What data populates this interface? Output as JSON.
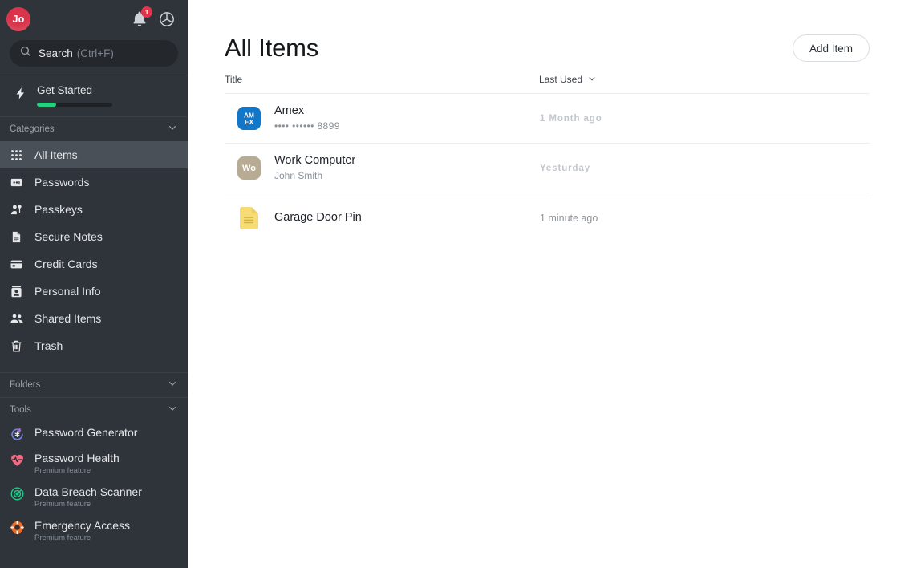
{
  "colors": {
    "sidebar_bg": "#2f343a",
    "sidebar_active": "#4a5057",
    "accent_green": "#27d07f",
    "badge_red": "#e0354b",
    "avatar_red": "#d9344a",
    "amex_blue": "#1277c9",
    "work_tan": "#b8ab93",
    "note_yellow": "#f7dc75"
  },
  "sidebar": {
    "avatar": {
      "initials": "Jo",
      "name": "user-avatar"
    },
    "notifications": {
      "icon": "bell-icon",
      "badge_count": "1"
    },
    "settings": {
      "icon": "gear-icon"
    },
    "search": {
      "icon": "search-icon",
      "label": "Search",
      "hint": "(Ctrl+F)",
      "placeholder": "Search (Ctrl+F)",
      "value": ""
    },
    "get_started": {
      "icon": "bolt-icon",
      "label": "Get Started",
      "progress_percent": 26
    },
    "categories": {
      "title": "Categories",
      "collapse_icon": "chevron-down-icon",
      "items": [
        {
          "label": "All Items",
          "icon": "grid-icon",
          "active": true
        },
        {
          "label": "Passwords",
          "icon": "password-icon",
          "active": false
        },
        {
          "label": "Passkeys",
          "icon": "passkey-icon",
          "active": false
        },
        {
          "label": "Secure Notes",
          "icon": "document-icon",
          "active": false
        },
        {
          "label": "Credit Cards",
          "icon": "credit-card-icon",
          "active": false
        },
        {
          "label": "Personal Info",
          "icon": "id-card-icon",
          "active": false
        },
        {
          "label": "Shared Items",
          "icon": "people-icon",
          "active": false
        },
        {
          "label": "Trash",
          "icon": "trash-icon",
          "active": false
        }
      ]
    },
    "folders": {
      "title": "Folders",
      "collapse_icon": "chevron-down-icon"
    },
    "tools": {
      "title": "Tools",
      "collapse_icon": "chevron-down-icon",
      "items": [
        {
          "label": "Password Generator",
          "sub": "",
          "icon": "password-generator-icon"
        },
        {
          "label": "Password Health",
          "sub": "Premium feature",
          "icon": "heart-pulse-icon"
        },
        {
          "label": "Data Breach Scanner",
          "sub": "Premium feature",
          "icon": "radar-target-icon"
        },
        {
          "label": "Emergency Access",
          "sub": "Premium feature",
          "icon": "life-ring-icon"
        }
      ]
    }
  },
  "main": {
    "title": "All Items",
    "add_button": "Add Item",
    "columns": {
      "title": "Title",
      "last_used": "Last Used",
      "sort_icon": "chevron-down-icon"
    },
    "rows": [
      {
        "title": "Amex",
        "sub": "•••• •••••• 8899",
        "time": "1 Month ago",
        "time_style": "bold",
        "icon": "amex-card-icon",
        "icon_kind": "amex",
        "initials": ""
      },
      {
        "title": "Work Computer",
        "sub": "John Smith",
        "time": "Yesturday",
        "time_style": "bold",
        "icon": "work-computer-avatar",
        "icon_kind": "initials",
        "initials": "Wo"
      },
      {
        "title": "Garage Door Pin",
        "sub": "",
        "time": "1 minute ago",
        "time_style": "plain",
        "icon": "secure-note-icon",
        "icon_kind": "note",
        "initials": ""
      }
    ]
  }
}
